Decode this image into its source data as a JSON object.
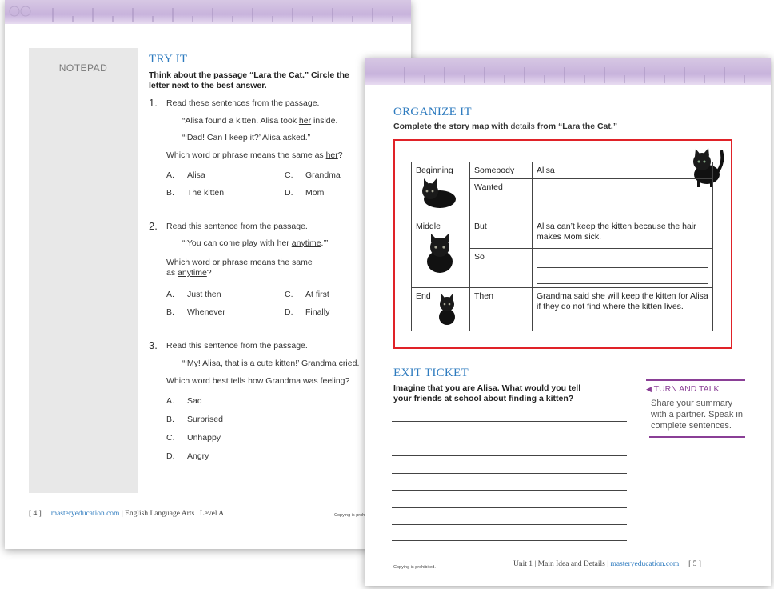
{
  "left_page": {
    "notepad_label": "NOTEPAD",
    "section_title": "TRY IT",
    "instruction_line1": "Think about the passage “Lara the Cat.” Circle the",
    "instruction_line2": "letter next to the best answer.",
    "questions": [
      {
        "number": "1.",
        "prompt": "Read these sentences from the passage.",
        "quote_line1_pre": "“Alisa found a kitten. Alisa took ",
        "quote_line1_u": "her",
        "quote_line1_post": " inside.",
        "quote_line2": "“‘Dad! Can I keep it?’ Alisa asked.”",
        "ask_pre": "Which word or phrase means the same as ",
        "ask_u": "her",
        "ask_post": "?",
        "choices": [
          "A.",
          "Alisa",
          "C.",
          "Grandma",
          "B.",
          "The kitten",
          "D.",
          "Mom"
        ]
      },
      {
        "number": "2.",
        "prompt": "Read this sentence from the passage.",
        "quote_pre": "“‘You can come play with her ",
        "quote_u": "anytime",
        "quote_post": ".’”",
        "ask_line1": "Which word or phrase means the same",
        "ask_line2_pre": "as ",
        "ask_line2_u": "anytime",
        "ask_line2_post": "?",
        "choices": [
          "A.",
          "Just then",
          "C.",
          "At first",
          "B.",
          "Whenever",
          "D.",
          "Finally"
        ]
      },
      {
        "number": "3.",
        "prompt": "Read this sentence from the passage.",
        "quote": "“‘My! Alisa, that is a cute kitten!’ Grandma cried.",
        "ask": "Which word best tells how Grandma was feeling?",
        "choices": [
          "A.",
          "Sad",
          "B.",
          "Surprised",
          "C.",
          "Unhappy",
          "D.",
          "Angry"
        ]
      }
    ],
    "footer": {
      "page": "[ 4 ]",
      "site": "masteryeducation.com",
      "sep1": "|",
      "subject": "English Language Arts",
      "sep2": "|",
      "level": "Level A",
      "copy": "Copying is prohibited."
    }
  },
  "right_page": {
    "section_title": "ORGANIZE IT",
    "instruction_b1": "Complete the story map with ",
    "instruction_n": "details",
    "instruction_b2": " from “Lara the Cat.”",
    "story_map": {
      "rows": [
        {
          "part": "Beginning",
          "label": "Somebody",
          "text": "Alisa"
        },
        {
          "part": "",
          "label": "Wanted",
          "text": ""
        },
        {
          "part": "Middle",
          "label": "But",
          "text": "Alisa can’t keep the kitten because the hair makes Mom sick."
        },
        {
          "part": "",
          "label": "So",
          "text": ""
        },
        {
          "part": "End",
          "label": "Then",
          "text": "Grandma said she will keep the kitten for Alisa if they do not find where the kitten lives."
        }
      ]
    },
    "exit_title": "EXIT TICKET",
    "exit_line1": "Imagine that you are Alisa. What would you tell",
    "exit_line2": "your friends at school about finding a kitten?",
    "turn_talk": {
      "heading": "TURN AND TALK",
      "body": "Share your summary with a partner. Speak in complete sentences."
    },
    "footer": {
      "copy": "Copying is prohibited.",
      "unit": "Unit 1",
      "sep1": "|",
      "topic": "Main Idea and Details",
      "sep2": "|",
      "site": "masteryeducation.com",
      "page": "[ 5 ]"
    }
  },
  "colors": {
    "title_blue": "#2e7bbf",
    "box_red": "#e02228",
    "purple": "#8a3f96",
    "ruler": "#c8b3dc"
  },
  "icons": [
    "kitten-photo"
  ]
}
